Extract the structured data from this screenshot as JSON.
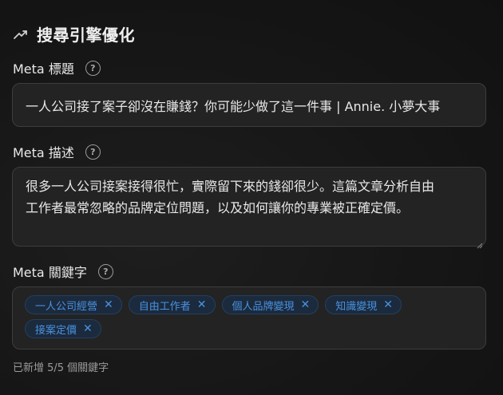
{
  "section": {
    "icon": "trending-up-icon",
    "title": "搜尋引擎優化"
  },
  "meta_title": {
    "label": "Meta 標題",
    "help_icon": "help-icon",
    "value": "一人公司接了案子卻沒在賺錢？你可能少做了這一件事 | Annie. 小夢大事"
  },
  "meta_description": {
    "label": "Meta 描述",
    "help_icon": "help-icon",
    "line1": "很多一人公司接案接得很忙，實際留下來的錢卻很少。這篇文章分析自由",
    "line2": "工作者最常忽略的品牌定位問題，以及如何讓你的專業被正確定價。"
  },
  "meta_keywords": {
    "label": "Meta 關鍵字",
    "help_icon": "help-icon",
    "chips": [
      {
        "label": "一人公司經營",
        "remove": "✕"
      },
      {
        "label": "自由工作者",
        "remove": "✕"
      },
      {
        "label": "個人品牌變現",
        "remove": "✕"
      },
      {
        "label": "知識變現",
        "remove": "✕"
      },
      {
        "label": "接案定價",
        "remove": "✕"
      }
    ],
    "count_note": "已新增 5/5 個關鍵字"
  },
  "colors": {
    "background": "#141414",
    "field_bg": "#232323",
    "chip_bg": "#1b2a3d",
    "chip_text": "#4a92e0"
  }
}
